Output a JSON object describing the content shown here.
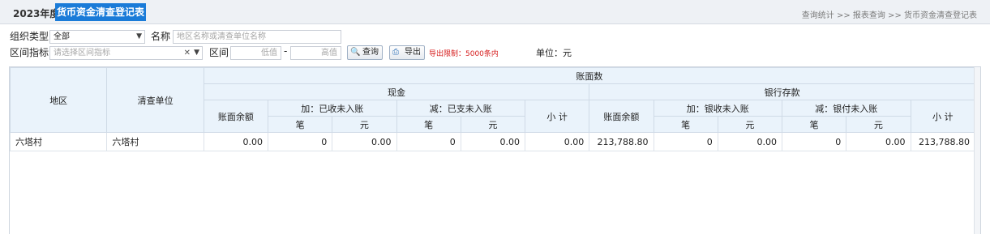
{
  "header": {
    "year": "2023年度",
    "title": "货币资金清查登记表",
    "breadcrumb": "查询统计 >> 报表查询 >> 货币资金清查登记表"
  },
  "filters": {
    "org_type_label": "组织类型",
    "org_type_value": "全部",
    "name_label": "名称",
    "name_placeholder": "地区名称或清查单位名称",
    "range_index_label": "区间指标",
    "range_index_placeholder": "请选择区间指标",
    "range_label": "区间",
    "range_low_placeholder": "低值",
    "range_sep": "-",
    "range_high_placeholder": "高值",
    "query_button": "查询",
    "export_button": "导出",
    "export_limit": "导出限制：5000条内",
    "unit_text": "单位：元"
  },
  "table": {
    "headers": {
      "region": "地区",
      "unit": "清查单位",
      "book_count": "账面数",
      "cash": "现金",
      "bank": "银行存款",
      "book_balance": "账面余额",
      "cash_add": "加：已收未入账",
      "cash_sub": "减：已支未入账",
      "bank_add": "加：银收未入账",
      "bank_sub": "减：银付未入账",
      "subtotal": "小 计",
      "bi": "笔",
      "yuan": "元"
    },
    "rows": [
      {
        "region": "六塔村",
        "unit": "六塔村",
        "cash_balance": "0.00",
        "cash_add_bi": "0",
        "cash_add_yuan": "0.00",
        "cash_sub_bi": "0",
        "cash_sub_yuan": "0.00",
        "cash_subtotal": "0.00",
        "bank_balance": "213,788.80",
        "bank_add_bi": "0",
        "bank_add_yuan": "0.00",
        "bank_sub_bi": "0",
        "bank_sub_yuan": "0.00",
        "bank_subtotal": "213,788.80"
      }
    ]
  },
  "icons": {
    "query": "search-icon",
    "export": "printer-export-icon",
    "select_arrow": "chevron-down-icon",
    "clear": "clear-x-icon"
  }
}
